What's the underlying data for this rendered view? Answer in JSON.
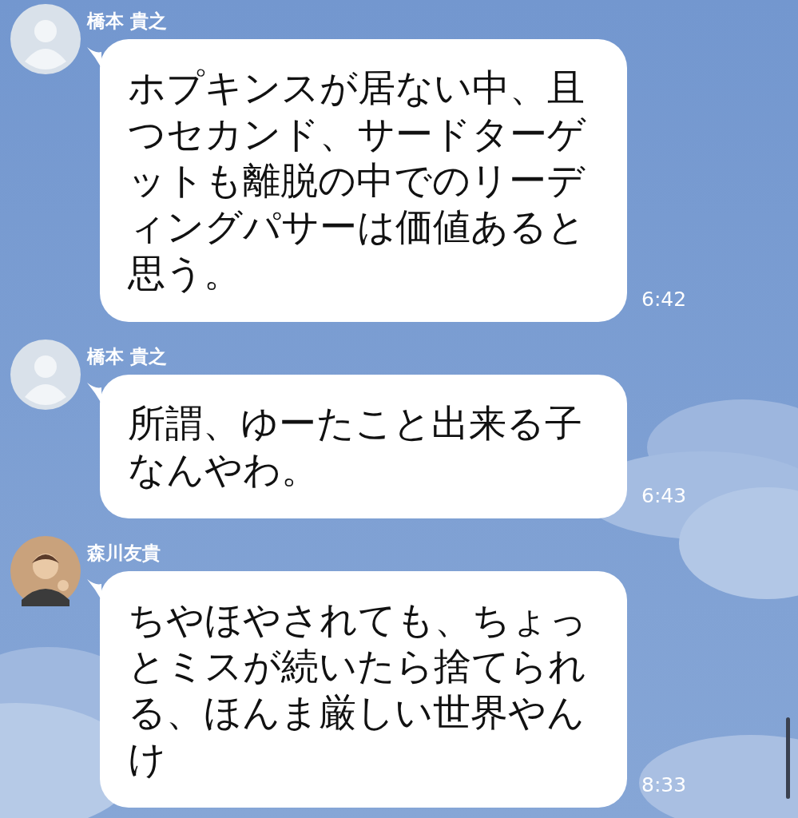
{
  "messages": [
    {
      "sender": "橋本 貴之",
      "avatar": {
        "kind": "default"
      },
      "text": "ホプキンスが居ない中、且つセカンド、サードターゲットも離脱の中でのリーディングパサーは価値あると思う。",
      "time": "6:42"
    },
    {
      "sender": "橋本 貴之",
      "avatar": {
        "kind": "default"
      },
      "text": "所謂、ゆーたこと出来る子なんやわ。",
      "time": "6:43"
    },
    {
      "sender": "森川友貴",
      "avatar": {
        "kind": "photo"
      },
      "text": "ちやほやされても、ちょっとミスが続いたら捨てられる、ほんま厳しい世界やんけ",
      "time": "8:33"
    }
  ]
}
